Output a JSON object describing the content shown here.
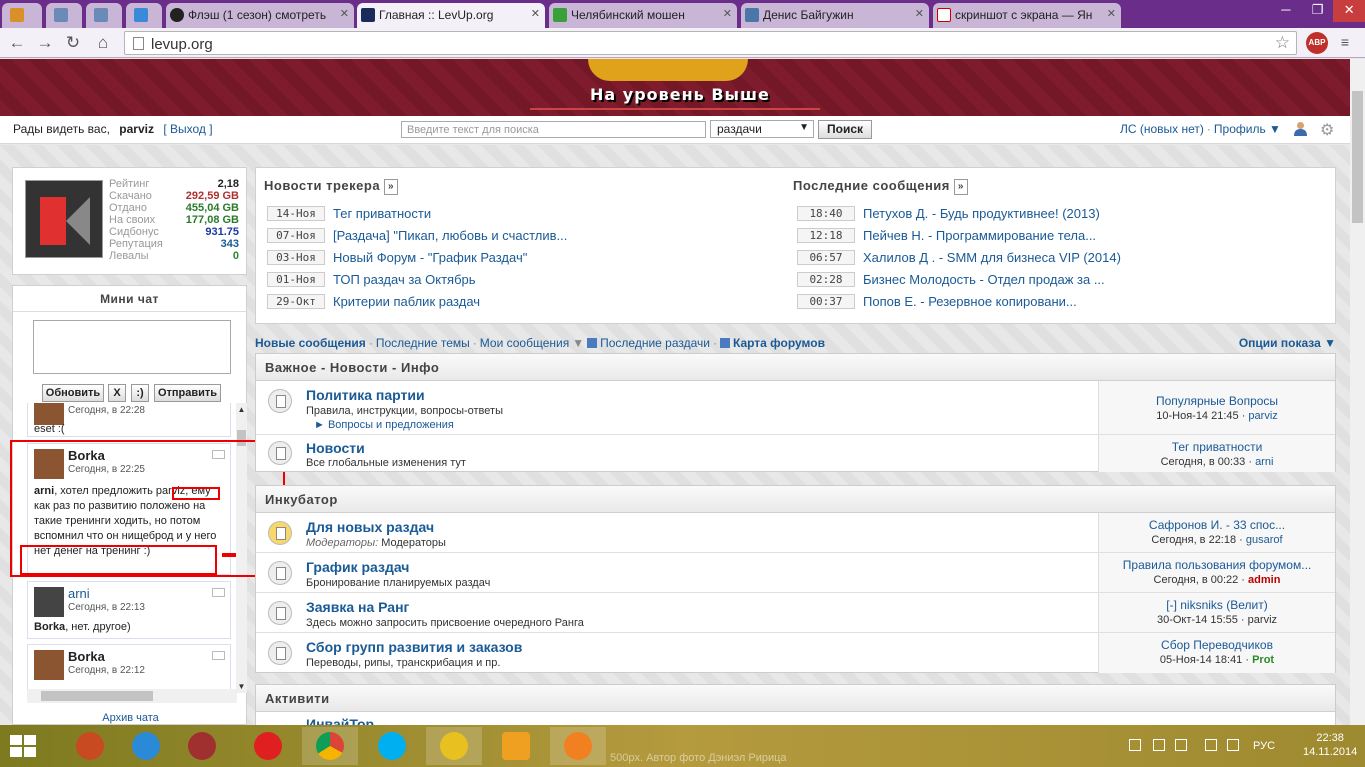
{
  "browser": {
    "tabs": [
      {
        "label": "",
        "pinned": true
      },
      {
        "label": "",
        "pinned": true
      },
      {
        "label": "",
        "pinned": true
      },
      {
        "label": "",
        "pinned": true
      },
      {
        "label": "Флэш (1 сезон) смотреть"
      },
      {
        "label": "Главная :: LevUp.org",
        "active": true
      },
      {
        "label": "Челябинский мошен"
      },
      {
        "label": "Денис Байгужин"
      },
      {
        "label": "скриншот с экрана — Ян"
      }
    ],
    "url": "levup.org",
    "abp_label": "ABP"
  },
  "header": {
    "slogan": "На уровень Выше"
  },
  "userbar": {
    "greeting": "Рады видеть вас,",
    "username": "parviz",
    "logout": "[ Выход ]",
    "search_placeholder": "Введите текст для поиска",
    "search_scope": "раздачи",
    "search_button": "Поиск",
    "pm_link": "ЛС (новых нет)",
    "profile_link": "Профиль ▼"
  },
  "stats": [
    {
      "key": "Рейтинг",
      "value": "2,18",
      "color": "#222"
    },
    {
      "key": "Скачано",
      "value": "292,59 GB",
      "color": "#b03030"
    },
    {
      "key": "Отдано",
      "value": "455,04 GB",
      "color": "#2a7a2a"
    },
    {
      "key": "На своих",
      "value": "177,08 GB",
      "color": "#2a7a2a"
    },
    {
      "key": "Сидбонус",
      "value": "931.75",
      "color": "#1a3aa0"
    },
    {
      "key": "Репутация",
      "value": "343",
      "color": "#1a5a96"
    },
    {
      "key": "Левалы",
      "value": "0",
      "color": "#2a8a2a"
    }
  ],
  "minichat": {
    "title": "Мини чат",
    "buttons": {
      "refresh": "Обновить",
      "clear": "X",
      "smile": ":)",
      "send": "Отправить"
    },
    "messages": [
      {
        "name": "",
        "time": "Сегодня, в 22:28",
        "text": "eset :("
      },
      {
        "name": "Borka",
        "time": "Сегодня, в 22:25",
        "text_bold": "arni",
        "text": ", хотел предложить parviz, ему как раз по развитию положено на такие тренинги ходить, но потом вспомнил что он нищеброд и у него нет денег на тренинг :)"
      },
      {
        "name": "arni",
        "time": "Сегодня, в 22:13",
        "text_bold": "Borka",
        "text": ", нет. другое)"
      },
      {
        "name": "Borka",
        "time": "Сегодня, в 22:12",
        "text": ""
      }
    ],
    "archive": "Архив чата"
  },
  "tracker_news": {
    "title": "Новости трекера",
    "items": [
      {
        "date": "14-Ноя",
        "title": "Тег приватности"
      },
      {
        "date": "07-Ноя",
        "title": "[Раздача] \"Пикап, любовь и счастлив..."
      },
      {
        "date": "03-Ноя",
        "title": "Новый Форум - \"График Раздач\""
      },
      {
        "date": "01-Ноя",
        "title": "ТОП раздач за Октябрь"
      },
      {
        "date": "29-Окт",
        "title": "Критерии паблик раздач"
      }
    ]
  },
  "latest_posts": {
    "title": "Последние сообщения",
    "items": [
      {
        "date": "18:40",
        "title": "Петухов Д. - Будь продуктивнее! (2013)"
      },
      {
        "date": "12:18",
        "title": "Пейчев Н. - Программирование тела..."
      },
      {
        "date": "06:57",
        "title": "Халилов Д . - SMM для бизнеса VIP (2014)"
      },
      {
        "date": "02:28",
        "title": "Бизнес Молодость - Отдел продаж за ..."
      },
      {
        "date": "00:37",
        "title": "Попов Е. - Резервное копировани..."
      }
    ]
  },
  "links": {
    "new_posts": "Новые сообщения",
    "latest_topics": "Последние темы",
    "my_posts": "Мои сообщения",
    "latest_releases": "Последние раздачи",
    "forum_map": "Карта форумов",
    "view_options": "Опции показа"
  },
  "categories": [
    {
      "title": "Важное - Новости - Инфо",
      "forums": [
        {
          "name": "Политика партии",
          "desc": "Правила, инструкции, вопросы-ответы",
          "sub": "► Вопросы и предложения",
          "last_title": "Популярные Вопросы",
          "last_date": "10-Ноя-14 21:45 ·",
          "last_user": "parviz"
        },
        {
          "name": "Новости",
          "desc": "Все глобальные изменения тут",
          "last_title": "Тег приватности",
          "last_date": "Сегодня, в 00:33 ·",
          "last_user": "arni"
        }
      ]
    },
    {
      "title": "Инкубатор",
      "forums": [
        {
          "name": "Для новых раздач",
          "desc_label": "Модераторы:",
          "desc": "Модераторы",
          "last_title": "Сафронов И. - 33 спос...",
          "last_date": "Сегодня, в 22:18 ·",
          "last_user": "gusarof"
        },
        {
          "name": "График раздач",
          "desc": "Бронирование планируемых раздач",
          "last_title": "Правила пользования форумом...",
          "last_date": "Сегодня, в 00:22 ·",
          "last_user": "admin"
        },
        {
          "name": "Заявка на Ранг",
          "desc": "Здесь можно запросить присвоение очередного Ранга",
          "last_title": "[-] niksniks (Велит)",
          "last_date": "30-Окт-14 15:55 ·",
          "last_user": "parviz"
        },
        {
          "name": "Сбор групп развития и заказов",
          "desc": "Переводы, рипы, транскрибация и пр.",
          "last_title": "Сбор Переводчиков",
          "last_date": "05-Ноя-14 18:41 ·",
          "last_user": "Prot"
        }
      ]
    },
    {
      "title": "Активити",
      "forums": [
        {
          "name": "ИнвайТор"
        }
      ]
    }
  ],
  "taskbar": {
    "lang": "РУС",
    "time": "22:38",
    "date": "14.11.2014",
    "watermark": "500px. Автор фото Дэниэл Ририца"
  }
}
